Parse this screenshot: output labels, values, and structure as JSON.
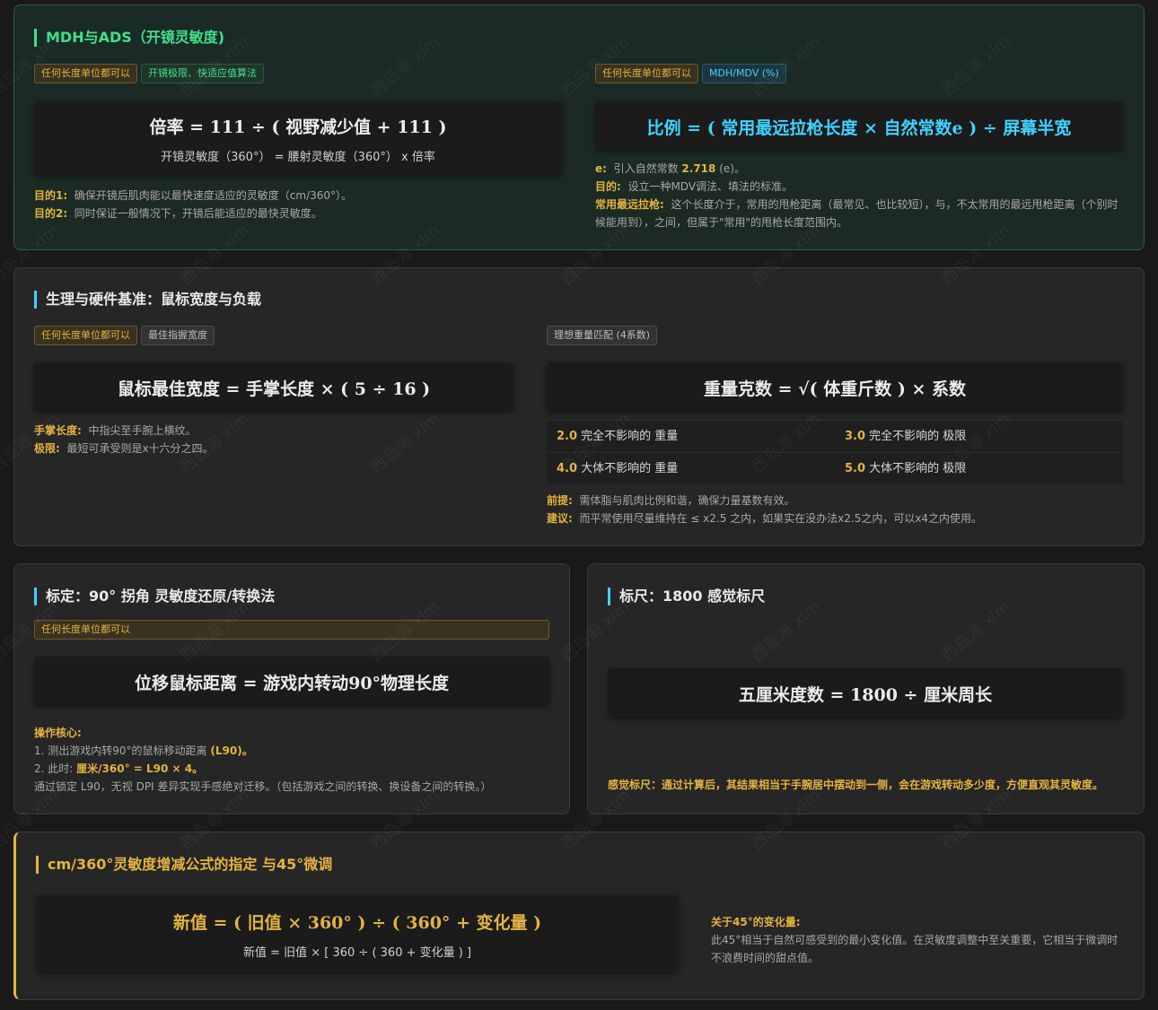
{
  "card1": {
    "title": "MDH与ADS（开镜灵敏度)",
    "left_tags": [
      "任何长度单位都可以",
      "开镜极限、快适应值算法"
    ],
    "right_tags": [
      "任何长度单位都可以",
      "MDH/MDV (%)"
    ],
    "left_formula": "倍率 = 111 ÷ ( 视野减少值 + 111 )",
    "left_sub": "开镜灵敏度（360°） = 腰射灵敏度（360°） x 倍率",
    "left_notes": [
      {
        "key": "目的1:",
        "text": "确保开镜后肌肉能以最快速度适应的灵敏度（cm/360°）。"
      },
      {
        "key": "目的2:",
        "text": "同时保证一般情况下，开镜后能适应的最快灵敏度。"
      }
    ],
    "right_formula": "比例 = ( 常用最远拉枪长度 × 自然常数e ) ÷ 屏幕半宽",
    "right_notes": [
      {
        "key": "e:",
        "text": "引入自然常数",
        "extra": "2.718",
        "tail": "(e)。"
      },
      {
        "key": "目的:",
        "text": "设立一种MDV调法、填法的标准。"
      },
      {
        "key": "常用最远拉枪:",
        "text": "这个长度介于，常用的甩枪距离（最常见、也比较短），与，不太常用的最远甩枪距离（个别时候能用到），之间，但属于\"常用\"的甩枪长度范围内。"
      }
    ]
  },
  "card2": {
    "title": "生理与硬件基准：鼠标宽度与负载",
    "left_tags": [
      "任何长度单位都可以",
      "最佳指握宽度"
    ],
    "right_tags": [
      "理想重量匹配 (4系数)"
    ],
    "left_formula": "鼠标最佳宽度 = 手掌长度 × ( 5 ÷ 16 )",
    "left_notes": [
      {
        "key": "手掌长度:",
        "text": "中指尖至手腕上横纹。"
      },
      {
        "key": "极限:",
        "text": "最短可承受则是x十六分之四。"
      }
    ],
    "right_formula": "重量克数 = √( 体重斤数 ) × 系数",
    "weights": [
      [
        {
          "num": "2.0",
          "text": "完全不影响的 重量"
        },
        {
          "num": "3.0",
          "text": "完全不影响的 极限"
        }
      ],
      [
        {
          "num": "4.0",
          "text": "大体不影响的 重量"
        },
        {
          "num": "5.0",
          "text": "大体不影响的 极限"
        }
      ]
    ],
    "right_notes": [
      {
        "key": "前提:",
        "text": "需体脂与肌肉比例和谐，确保力量基数有效。"
      },
      {
        "key": "建议:",
        "text": "而平常使用尽量维持在 ≤ x2.5 之内，如果实在没办法x2.5之内，可以x4之内使用。"
      }
    ]
  },
  "card3": {
    "title": "标定：90° 拐角 灵敏度还原/转换法",
    "tag": "任何长度单位都可以",
    "formula": "位移鼠标距离 = 游戏内转动90°物理长度",
    "core_label": "操作核心:",
    "step1": "1. 测出游戏内转90°的鼠标移动距离",
    "step1_hl": "(L90)。",
    "step2": "2. 此时:",
    "step2_hl": "厘米/360° = L90 × 4。",
    "step3": "通过锁定 L90，无视 DPI 差异实现手感绝对迁移。（包括游戏之间的转换、换设备之间的转换。）"
  },
  "card4": {
    "title": "标尺：1800 感觉标尺",
    "formula": "五厘米度数 = 1800 ÷ 厘米周长",
    "note": "感觉标尺：通过计算后，其结果相当于手腕居中摆动到一侧，会在游戏转动多少度，方便直观其灵敏度。"
  },
  "card5": {
    "title": "cm/360°灵敏度增减公式的指定 与45°微调",
    "formula": "新值 = ( 旧值 × 360° ) ÷ ( 360° + 变化量 )",
    "sub": "新值 = 旧值 × [ 360 ÷ ( 360 + 变化量 ) ]",
    "note_key": "关于45°的变化量:",
    "note_text": "此45°相当于自然可感受到的最小变化值。在灵敏度调整中至关重要，它相当于微调时不浪费时间的甜点值。"
  },
  "watermark": "西岛海 xlm",
  "colors": {
    "gold": "#e3b341",
    "green": "#3fe08a",
    "cyan": "#3fd3ff"
  }
}
